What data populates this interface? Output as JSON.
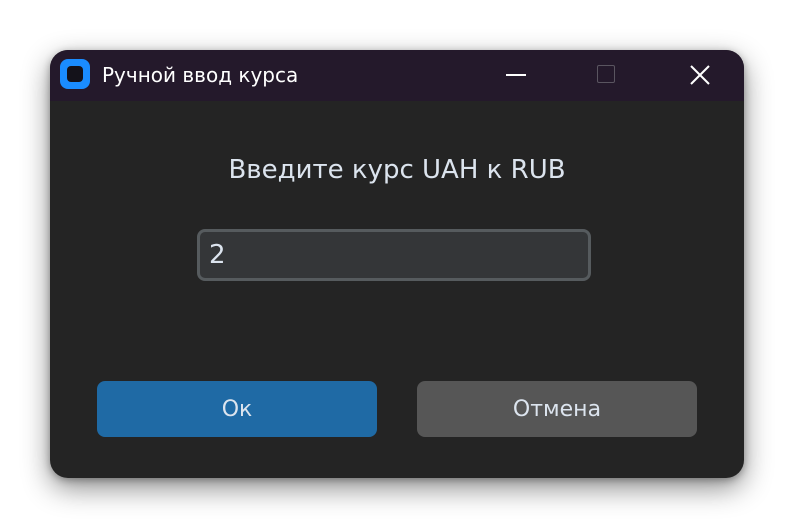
{
  "window": {
    "title": "Ручной ввод курса",
    "controls": {
      "minimize_icon": "minimize-icon",
      "maximize_icon": "maximize-icon",
      "close_icon": "close-icon"
    }
  },
  "dialog": {
    "prompt": "Введите курс UAH к RUB",
    "rate_input_value": "2",
    "ok_label": "Ок",
    "cancel_label": "Отмена"
  },
  "colors": {
    "background": "#242424",
    "titlebar": "#24192b",
    "accent_button": "#1f6aa5",
    "secondary_button": "#565656",
    "input_background": "#343638",
    "input_border": "#565b5e",
    "text": "#dce4ee"
  }
}
